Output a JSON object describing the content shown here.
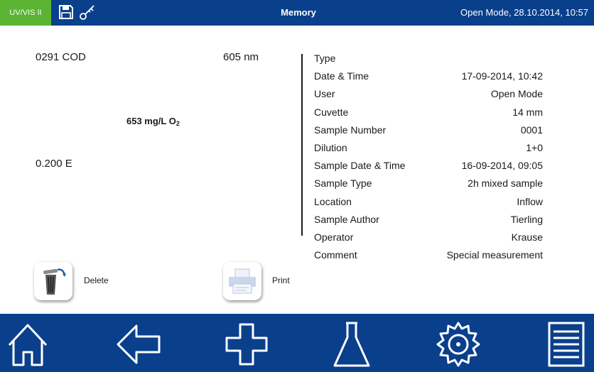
{
  "header": {
    "mode_badge": "UV/VIS II",
    "title": "Memory",
    "status": "Open Mode, 28.10.2014, 10:57",
    "icons": [
      "save-icon",
      "key-icon"
    ]
  },
  "measurement": {
    "method": "0291 COD",
    "wavelength": "605 nm",
    "result_value": "653 mg/L O",
    "result_subscript": "2",
    "absorbance": "0.200 E"
  },
  "details": [
    {
      "label": "Type",
      "value": ""
    },
    {
      "label": "Date & Time",
      "value": "17-09-2014, 10:42"
    },
    {
      "label": "User",
      "value": "Open Mode"
    },
    {
      "label": "Cuvette",
      "value": "14 mm"
    },
    {
      "label": "Sample Number",
      "value": "0001"
    },
    {
      "label": "Dilution",
      "value": "1+0"
    },
    {
      "label": "Sample Date & Time",
      "value": "16-09-2014, 09:05"
    },
    {
      "label": "Sample Type",
      "value": "2h mixed sample"
    },
    {
      "label": "Location",
      "value": "Inflow"
    },
    {
      "label": "Sample Author",
      "value": "Tierling"
    },
    {
      "label": "Operator",
      "value": "Krause"
    },
    {
      "label": "Comment",
      "value": "Special measurement"
    }
  ],
  "actions": {
    "delete_label": "Delete",
    "print_label": "Print"
  },
  "navbar": {
    "icons": [
      "home-icon",
      "back-arrow-icon",
      "plus-icon",
      "flask-icon",
      "settings-gear-icon",
      "menu-list-icon"
    ]
  },
  "colors": {
    "header_bg": "#0a3f8c",
    "badge_bg": "#5ab431",
    "navbar_bg": "#0a3f8c"
  }
}
